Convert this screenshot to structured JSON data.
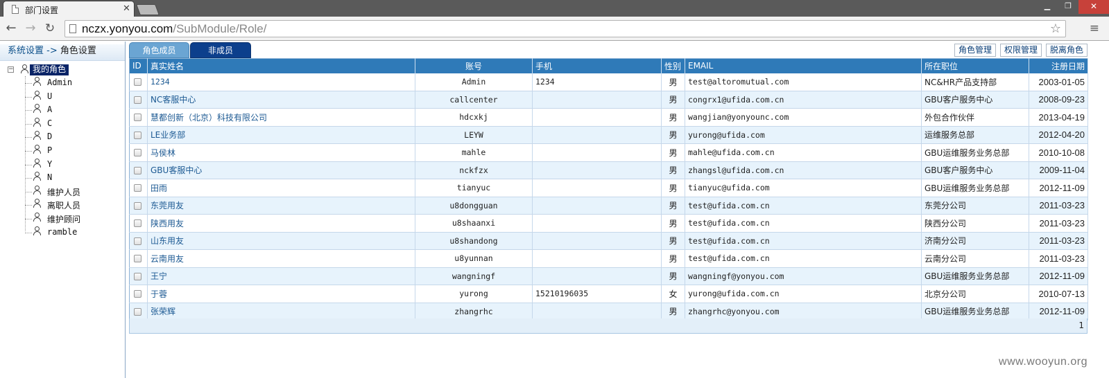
{
  "browser": {
    "tab_title": "部门设置",
    "url_host": "nczx.yonyou.com",
    "url_path": "/SubModule/Role/"
  },
  "left": {
    "breadcrumb_root": "系统设置",
    "breadcrumb_sep": "->",
    "breadcrumb_current": "角色设置",
    "tree_root": "我的角色",
    "tree_items": [
      "Admin",
      "U",
      "A",
      "C",
      "D",
      "P",
      "Y",
      "N",
      "维护人员",
      "离职人员",
      "维护顾问",
      "ramble"
    ]
  },
  "main": {
    "tabs": [
      "角色成员",
      "非成员"
    ],
    "actions": [
      "角色管理",
      "权限管理",
      "脱离角色"
    ],
    "columns": [
      "ID",
      "真实姓名",
      "账号",
      "手机",
      "性别",
      "EMAIL",
      "所在职位",
      "注册日期"
    ],
    "rows": [
      {
        "name": "1234",
        "account": "Admin",
        "phone": "1234",
        "gender": "男",
        "email": "test@altoromutual.com",
        "position": "NC&HR产品支持部",
        "date": "2003-01-05"
      },
      {
        "name": "NC客服中心",
        "account": "callcenter",
        "phone": "",
        "gender": "男",
        "email": "congrx1@ufida.com.cn",
        "position": "GBU客户服务中心",
        "date": "2008-09-23"
      },
      {
        "name": "慧都创新（北京）科技有限公司",
        "account": "hdcxkj",
        "phone": "",
        "gender": "男",
        "email": "wangjian@yonyounc.com",
        "position": "外包合作伙伴",
        "date": "2013-04-19"
      },
      {
        "name": "LE业务部",
        "account": "LEYW",
        "phone": "",
        "gender": "男",
        "email": "yurong@ufida.com",
        "position": "运维服务总部",
        "date": "2012-04-20"
      },
      {
        "name": "马侯林",
        "account": "mahle",
        "phone": "",
        "gender": "男",
        "email": "mahle@ufida.com.cn",
        "position": "GBU运维服务业务总部",
        "date": "2010-10-08"
      },
      {
        "name": "GBU客服中心",
        "account": "nckfzx",
        "phone": "",
        "gender": "男",
        "email": "zhangsl@ufida.com.cn",
        "position": "GBU客户服务中心",
        "date": "2009-11-04"
      },
      {
        "name": "田雨",
        "account": "tianyuc",
        "phone": "",
        "gender": "男",
        "email": "tianyuc@ufida.com",
        "position": "GBU运维服务业务总部",
        "date": "2012-11-09"
      },
      {
        "name": "东莞用友",
        "account": "u8dongguan",
        "phone": "",
        "gender": "男",
        "email": "test@ufida.com.cn",
        "position": "东莞分公司",
        "date": "2011-03-23"
      },
      {
        "name": "陕西用友",
        "account": "u8shaanxi",
        "phone": "",
        "gender": "男",
        "email": "test@ufida.com.cn",
        "position": "陕西分公司",
        "date": "2011-03-23"
      },
      {
        "name": "山东用友",
        "account": "u8shandong",
        "phone": "",
        "gender": "男",
        "email": "test@ufida.com.cn",
        "position": "济南分公司",
        "date": "2011-03-23"
      },
      {
        "name": "云南用友",
        "account": "u8yunnan",
        "phone": "",
        "gender": "男",
        "email": "test@ufida.com.cn",
        "position": "云南分公司",
        "date": "2011-03-23"
      },
      {
        "name": "王宁",
        "account": "wangningf",
        "phone": "",
        "gender": "男",
        "email": "wangningf@yonyou.com",
        "position": "GBU运维服务业务总部",
        "date": "2012-11-09"
      },
      {
        "name": "于蓉",
        "account": "yurong",
        "phone": "15210196035",
        "gender": "女",
        "email": "yurong@ufida.com.cn",
        "position": "北京分公司",
        "date": "2010-07-13"
      },
      {
        "name": "张荣辉",
        "account": "zhangrhc",
        "phone": "",
        "gender": "男",
        "email": "zhangrhc@yonyou.com",
        "position": "GBU运维服务业务总部",
        "date": "2012-11-09"
      }
    ],
    "page": "1"
  },
  "watermark": "www.wooyun.org"
}
